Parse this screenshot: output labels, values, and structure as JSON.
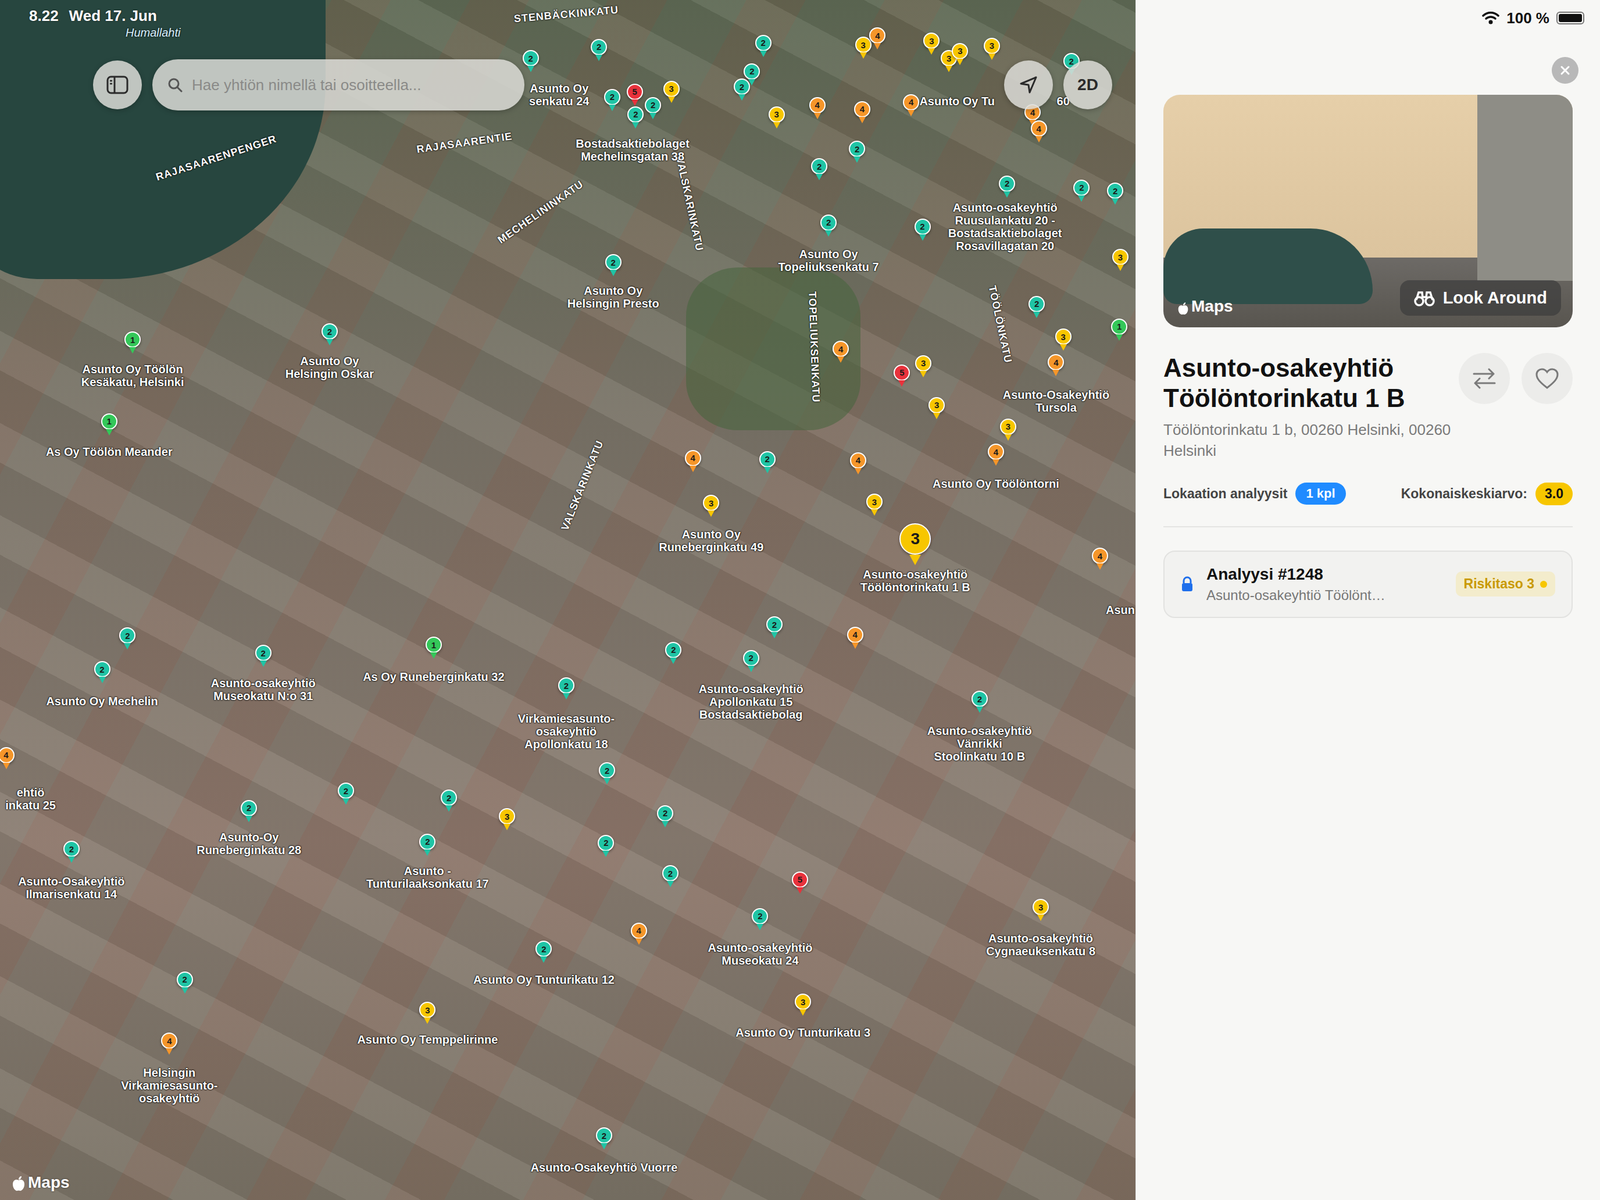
{
  "status_bar": {
    "time": "8.22",
    "date": "Wed 17. Jun",
    "battery": "100 %",
    "battery_level": 1
  },
  "search": {
    "placeholder": "Hae yhtiön nimellä tai osoitteella..."
  },
  "map_buttons": [
    "2D"
  ],
  "map": {
    "water_label": "Humallahti",
    "street_labels": [
      "STENBÄCKINKATU",
      "RAJASAARENPENGER",
      "RAJASAARENTIE",
      "MECHELININKATU",
      "VALSKARINKATU",
      "TOPELIUKSENKATU",
      "VALSKARINKATU",
      "TÖÖLÖNKATU"
    ],
    "extra_labels": [
      "60"
    ],
    "attribution": "Maps"
  },
  "pins": [
    {
      "number": "2",
      "label": "Asunto Oy\nsenkatu 24",
      "color": "#20c4a5",
      "selected": false
    },
    {
      "number": "2",
      "label": "Bostadsaktiebolaget\nMechelinsgatan 38",
      "color": "#20c4a5",
      "selected": false
    },
    {
      "number": "4",
      "label": "Asunto Oy Tu",
      "color": "#f5962a",
      "selected": false
    },
    {
      "number": "2",
      "label": "Asunto-osakeyhtiö\nRuusulankatu 20 -\nBostadsaktiebolaget\nRosavillagatan 20",
      "color": "#20c4a5",
      "selected": false
    },
    {
      "number": "2",
      "label": "Asunto Oy\nTopeliuksenkatu 7",
      "color": "#20c4a5",
      "selected": false
    },
    {
      "number": "2",
      "label": "Asunto Oy\nHelsingin Presto",
      "color": "#20c4a5",
      "selected": false
    },
    {
      "number": "1",
      "label": "Asunto Oy Töölön\nKesäkatu, Helsinki",
      "color": "#34c759",
      "selected": false
    },
    {
      "number": "2",
      "label": "Asunto Oy\nHelsingin Oskar",
      "color": "#20c4a5",
      "selected": false
    },
    {
      "number": "1",
      "label": "As Oy Töölön Meander",
      "color": "#34c759",
      "selected": false
    },
    {
      "number": "4",
      "label": "Asunto-Osakeyhtiö\nTursola",
      "color": "#f5962a",
      "selected": false
    },
    {
      "number": "4",
      "label": "Asunto Oy Töölöntorni",
      "color": "#f5962a",
      "selected": false
    },
    {
      "number": "3",
      "label": "Asunto Oy\nRuneberginkatu 49",
      "color": "#f7c600",
      "selected": false
    },
    {
      "number": "3",
      "label": "Asunto-osakeyhtiö\nTöölöntorinkatu 1 B",
      "color": "#f7c600",
      "selected": true
    },
    {
      "number": "4",
      "label": "Asun",
      "color": "#f5962a",
      "selected": false
    },
    {
      "number": "2",
      "label": "Asunto Oy Mechelin",
      "color": "#20c4a5",
      "selected": false
    },
    {
      "number": "2",
      "label": "Asunto-osakeyhtiö\nMuseokatu N:o 31",
      "color": "#20c4a5",
      "selected": false
    },
    {
      "number": "1",
      "label": "As Oy Runeberginkatu 32",
      "color": "#34c759",
      "selected": false
    },
    {
      "number": "2",
      "label": "Virkamiesasunto-\nosakeyhtiö\nApollonkatu 18",
      "color": "#20c4a5",
      "selected": false
    },
    {
      "number": "2",
      "label": "Asunto-osakeyhtiö\nApollonkatu 15\nBostadsaktiebolag",
      "color": "#20c4a5",
      "selected": false
    },
    {
      "number": "2",
      "label": "Asunto-osakeyhtiö\nVänrikki\nStoolinkatu 10 B",
      "color": "#20c4a5",
      "selected": false
    },
    {
      "number": "4",
      "label": "ehtiö\ninkatu 25",
      "color": "#f5962a",
      "selected": false
    },
    {
      "number": "2",
      "label": "Asunto-Oy\nRuneberginkatu 28",
      "color": "#20c4a5",
      "selected": false
    },
    {
      "number": "2",
      "label": "Asunto -\nTunturilaaksonkatu 17",
      "color": "#20c4a5",
      "selected": false
    },
    {
      "number": "2",
      "label": "Asunto-Osakeyhtiö\nIlmarisenkatu 14",
      "color": "#20c4a5",
      "selected": false
    },
    {
      "number": "3",
      "label": "Asunto-osakeyhtiö\nCygnaeuksenkatu 8",
      "color": "#f7c600",
      "selected": false
    },
    {
      "number": "2",
      "label": "Asunto-osakeyhtiö\nMuseokatu 24",
      "color": "#20c4a5",
      "selected": false
    },
    {
      "number": "2",
      "label": "Asunto Oy Tunturikatu 12",
      "color": "#20c4a5",
      "selected": false
    },
    {
      "number": "3",
      "label": "Asunto Oy Temppelirinne",
      "color": "#f7c600",
      "selected": false
    },
    {
      "number": "3",
      "label": "Asunto Oy Tunturikatu 3",
      "color": "#f7c600",
      "selected": false
    },
    {
      "number": "4",
      "label": "Helsingin\nVirkamiesasunto-\nosakeyhtiö",
      "color": "#f5962a",
      "selected": false
    },
    {
      "number": "2",
      "label": "Asunto-Osakeyhtiö Vuorre",
      "color": "#20c4a5",
      "selected": false
    },
    {
      "number": "2",
      "label": "",
      "color": "#20c4a5",
      "selected": false
    },
    {
      "number": "3",
      "label": "",
      "color": "#f7c600",
      "selected": false
    },
    {
      "number": "5",
      "label": "",
      "color": "#e8323c",
      "selected": false
    },
    {
      "number": "2",
      "label": "",
      "color": "#20c4a5",
      "selected": false
    },
    {
      "number": "2",
      "label": "",
      "color": "#20c4a5",
      "selected": false
    },
    {
      "number": "2",
      "label": "",
      "color": "#20c4a5",
      "selected": false
    },
    {
      "number": "2",
      "label": "",
      "color": "#20c4a5",
      "selected": false
    },
    {
      "number": "2",
      "label": "",
      "color": "#20c4a5",
      "selected": false
    },
    {
      "number": "3",
      "label": "",
      "color": "#f7c600",
      "selected": false
    },
    {
      "number": "4",
      "label": "",
      "color": "#f5962a",
      "selected": false
    },
    {
      "number": "4",
      "label": "",
      "color": "#f5962a",
      "selected": false
    },
    {
      "number": "3",
      "label": "",
      "color": "#f7c600",
      "selected": false
    },
    {
      "number": "4",
      "label": "",
      "color": "#f5962a",
      "selected": false
    },
    {
      "number": "4",
      "label": "",
      "color": "#f5962a",
      "selected": false
    },
    {
      "number": "3",
      "label": "",
      "color": "#f7c600",
      "selected": false
    },
    {
      "number": "3",
      "label": "",
      "color": "#f7c600",
      "selected": false
    },
    {
      "number": "3",
      "label": "",
      "color": "#f7c600",
      "selected": false
    },
    {
      "number": "3",
      "label": "",
      "color": "#f7c600",
      "selected": false
    },
    {
      "number": "2",
      "label": "",
      "color": "#20c4a5",
      "selected": false
    },
    {
      "number": "4",
      "label": "",
      "color": "#f5962a",
      "selected": false
    },
    {
      "number": "2",
      "label": "",
      "color": "#20c4a5",
      "selected": false
    },
    {
      "number": "2",
      "label": "",
      "color": "#20c4a5",
      "selected": false
    },
    {
      "number": "3",
      "label": "",
      "color": "#f7c600",
      "selected": false
    },
    {
      "number": "2",
      "label": "",
      "color": "#20c4a5",
      "selected": false
    },
    {
      "number": "3",
      "label": "",
      "color": "#f7c600",
      "selected": false
    },
    {
      "number": "1",
      "label": "",
      "color": "#34c759",
      "selected": false
    },
    {
      "number": "2",
      "label": "",
      "color": "#20c4a5",
      "selected": false
    },
    {
      "number": "2",
      "label": "",
      "color": "#20c4a5",
      "selected": false
    },
    {
      "number": "2",
      "label": "",
      "color": "#20c4a5",
      "selected": false
    },
    {
      "number": "4",
      "label": "",
      "color": "#f5962a",
      "selected": false
    },
    {
      "number": "5",
      "label": "",
      "color": "#e8323c",
      "selected": false
    },
    {
      "number": "3",
      "label": "",
      "color": "#f7c600",
      "selected": false
    },
    {
      "number": "3",
      "label": "",
      "color": "#f7c600",
      "selected": false
    },
    {
      "number": "3",
      "label": "",
      "color": "#f7c600",
      "selected": false
    },
    {
      "number": "4",
      "label": "",
      "color": "#f5962a",
      "selected": false
    },
    {
      "number": "2",
      "label": "",
      "color": "#20c4a5",
      "selected": false
    },
    {
      "number": "4",
      "label": "",
      "color": "#f5962a",
      "selected": false
    },
    {
      "number": "3",
      "label": "",
      "color": "#f7c600",
      "selected": false
    },
    {
      "number": "2",
      "label": "",
      "color": "#20c4a5",
      "selected": false
    },
    {
      "number": "4",
      "label": "",
      "color": "#f5962a",
      "selected": false
    },
    {
      "number": "2",
      "label": "",
      "color": "#20c4a5",
      "selected": false
    },
    {
      "number": "2",
      "label": "",
      "color": "#20c4a5",
      "selected": false
    },
    {
      "number": "3",
      "label": "",
      "color": "#f7c600",
      "selected": false
    },
    {
      "number": "2",
      "label": "",
      "color": "#20c4a5",
      "selected": false
    },
    {
      "number": "2",
      "label": "",
      "color": "#20c4a5",
      "selected": false
    },
    {
      "number": "2",
      "label": "",
      "color": "#20c4a5",
      "selected": false
    },
    {
      "number": "2",
      "label": "",
      "color": "#20c4a5",
      "selected": false
    },
    {
      "number": "2",
      "label": "",
      "color": "#20c4a5",
      "selected": false
    },
    {
      "number": "2",
      "label": "",
      "color": "#20c4a5",
      "selected": false
    },
    {
      "number": "5",
      "label": "",
      "color": "#e8323c",
      "selected": false
    },
    {
      "number": "4",
      "label": "",
      "color": "#f5962a",
      "selected": false
    },
    {
      "number": "2",
      "label": "",
      "color": "#20c4a5",
      "selected": false
    }
  ],
  "detail_panel": {
    "photo": {
      "attribution": "Maps",
      "look_around": "Look Around"
    },
    "title_lines": [
      "Asunto-osakeyhtiö",
      "Töölöntorinkatu 1 B"
    ],
    "address": "Töölöntorinkatu 1 b, 00260 Helsinki, 00260 Helsinki",
    "favorite": false,
    "stats": {
      "analyses_label": "Lokaation analyysit",
      "analyses_count": "1 kpl",
      "average_label": "Kokonaiskeskiarvo:",
      "average": "3.0",
      "average_color": "#f7c600"
    },
    "analyses": [
      {
        "title": "Analyysi #1248",
        "subtitle": "Asunto-osakeyhtiö Töölönt…",
        "risk": "Riskitaso 3",
        "color": "#f7c600",
        "locked": true
      }
    ]
  }
}
